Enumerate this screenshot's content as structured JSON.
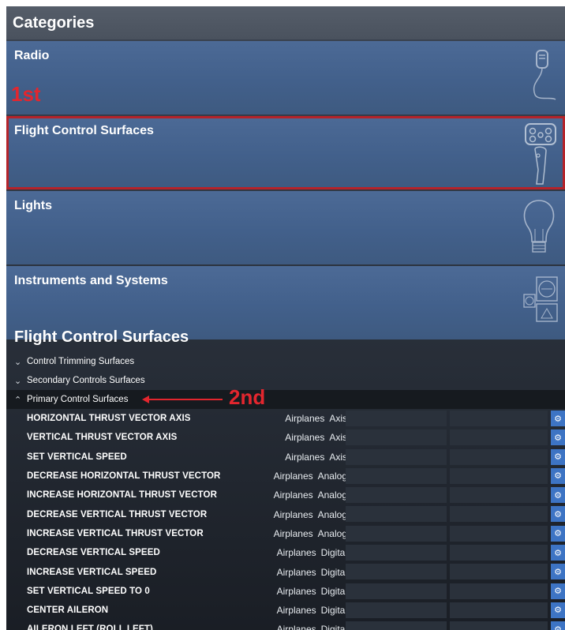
{
  "categories": {
    "title": "Categories",
    "items": [
      {
        "label": "Radio",
        "icon": "radio-mic-icon"
      },
      {
        "label": "Flight Control Surfaces",
        "icon": "yoke-icon",
        "selected": true
      },
      {
        "label": "Lights",
        "icon": "lightbulb-icon"
      },
      {
        "label": "Instruments and Systems",
        "icon": "instruments-icon"
      }
    ]
  },
  "annotations": {
    "first": "1st",
    "second": "2nd"
  },
  "section": {
    "title": "Flight Control Surfaces",
    "groups": [
      {
        "label": "Control Trimming Surfaces",
        "expanded": false
      },
      {
        "label": "Secondary Controls Surfaces",
        "expanded": false
      },
      {
        "label": "Primary Control Surfaces",
        "expanded": true
      }
    ],
    "rows": [
      {
        "name": "HORIZONTAL THRUST VECTOR AXIS",
        "device": "Airplanes",
        "type": "Axis"
      },
      {
        "name": "VERTICAL THRUST VECTOR AXIS",
        "device": "Airplanes",
        "type": "Axis"
      },
      {
        "name": "SET VERTICAL SPEED",
        "device": "Airplanes",
        "type": "Axis"
      },
      {
        "name": "DECREASE HORIZONTAL THRUST VECTOR",
        "device": "Airplanes",
        "type": "Analog"
      },
      {
        "name": "INCREASE HORIZONTAL THRUST VECTOR",
        "device": "Airplanes",
        "type": "Analog"
      },
      {
        "name": "DECREASE VERTICAL THRUST VECTOR",
        "device": "Airplanes",
        "type": "Analog"
      },
      {
        "name": "INCREASE VERTICAL THRUST VECTOR",
        "device": "Airplanes",
        "type": "Analog"
      },
      {
        "name": "DECREASE VERTICAL SPEED",
        "device": "Airplanes",
        "type": "Digital"
      },
      {
        "name": "INCREASE VERTICAL SPEED",
        "device": "Airplanes",
        "type": "Digital"
      },
      {
        "name": "SET VERTICAL SPEED TO 0",
        "device": "Airplanes",
        "type": "Digital"
      },
      {
        "name": "CENTER AILERON",
        "device": "Airplanes",
        "type": "Digital"
      },
      {
        "name": "AILERON LEFT (ROLL LEFT)",
        "device": "Airplanes",
        "type": "Digital"
      }
    ]
  },
  "colors": {
    "tile": "#4c6a96",
    "selected_outline": "#b5232a",
    "annotation": "#e3262e",
    "gear": "#3d74c4"
  }
}
